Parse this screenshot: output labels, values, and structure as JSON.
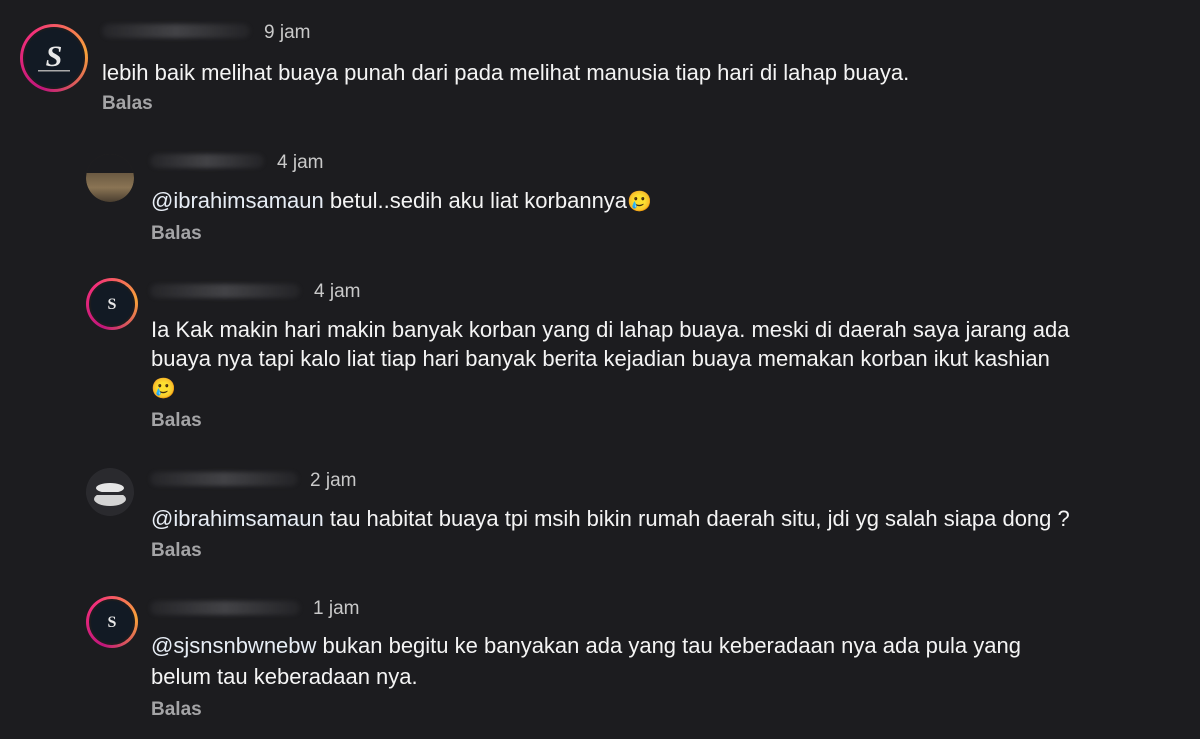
{
  "comments": [
    {
      "time": "9 jam",
      "text": "lebih baik melihat buaya punah dari pada melihat manusia tiap hari di lahap buaya.",
      "reply_label": "Balas",
      "avatar_letter": "S"
    },
    {
      "time": "4 jam",
      "mention": "@ibrahimsamaun",
      "text": " betul..sedih aku liat korbannya",
      "emoji": "🥲",
      "reply_label": "Balas"
    },
    {
      "time": "4 jam",
      "line1": "Ia Kak makin hari makin banyak korban yang di lahap buaya. meski di daerah saya jarang ada",
      "line2": "buaya nya tapi kalo liat tiap hari banyak berita kejadian  buaya memakan korban ikut kashian",
      "emoji": "🥲",
      "reply_label": "Balas"
    },
    {
      "time": "2 jam",
      "mention": "@ibrahimsamaun",
      "text": " tau habitat buaya tpi msih bikin rumah daerah situ, jdi yg salah siapa dong ?",
      "reply_label": "Balas"
    },
    {
      "time": "1 jam",
      "mention": "@sjsnsnbwnebw",
      "text": " bukan begitu ke banyakan ada yang tau keberadaan nya ada pula yang",
      "line2": "belum tau keberadaan nya.",
      "reply_label": "Balas"
    }
  ]
}
